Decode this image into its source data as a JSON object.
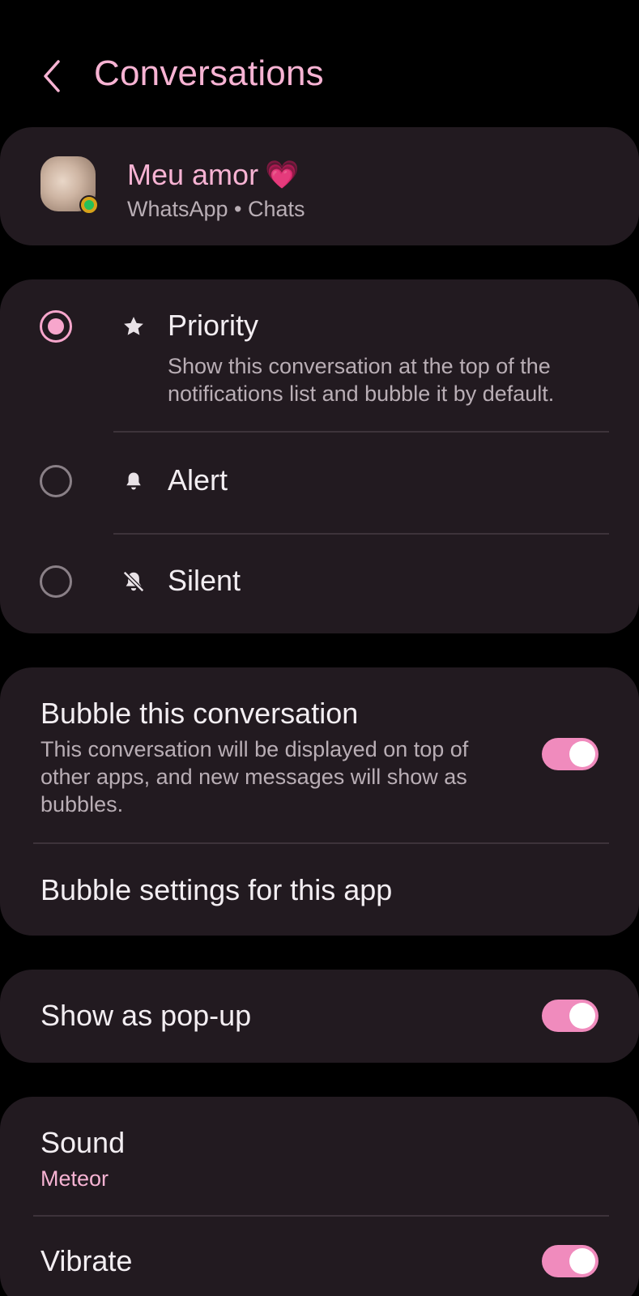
{
  "header": {
    "title": "Conversations"
  },
  "contact": {
    "name": "Meu amor",
    "emoji": "💗",
    "subtitle": "WhatsApp • Chats"
  },
  "importance": {
    "options": [
      {
        "label": "Priority",
        "description": "Show this conversation at the top of the notifications list and bubble it by default.",
        "icon": "star-icon",
        "selected": true
      },
      {
        "label": "Alert",
        "icon": "bell-icon",
        "selected": false
      },
      {
        "label": "Silent",
        "icon": "bell-off-icon",
        "selected": false
      }
    ]
  },
  "bubble": {
    "title": "Bubble this conversation",
    "description": "This conversation will be displayed on top of other apps, and new messages will show as bubbles.",
    "enabled": true,
    "settings_label": "Bubble settings for this app"
  },
  "popup": {
    "label": "Show as pop-up",
    "enabled": true
  },
  "sound": {
    "label": "Sound",
    "value": "Meteor"
  },
  "vibrate": {
    "label": "Vibrate",
    "enabled": true
  },
  "colors": {
    "background": "#000000",
    "card": "#221a20",
    "accent": "#f7b3d3",
    "toggle_on": "#f08bbd",
    "secondary_text": "#b9aeb5"
  }
}
